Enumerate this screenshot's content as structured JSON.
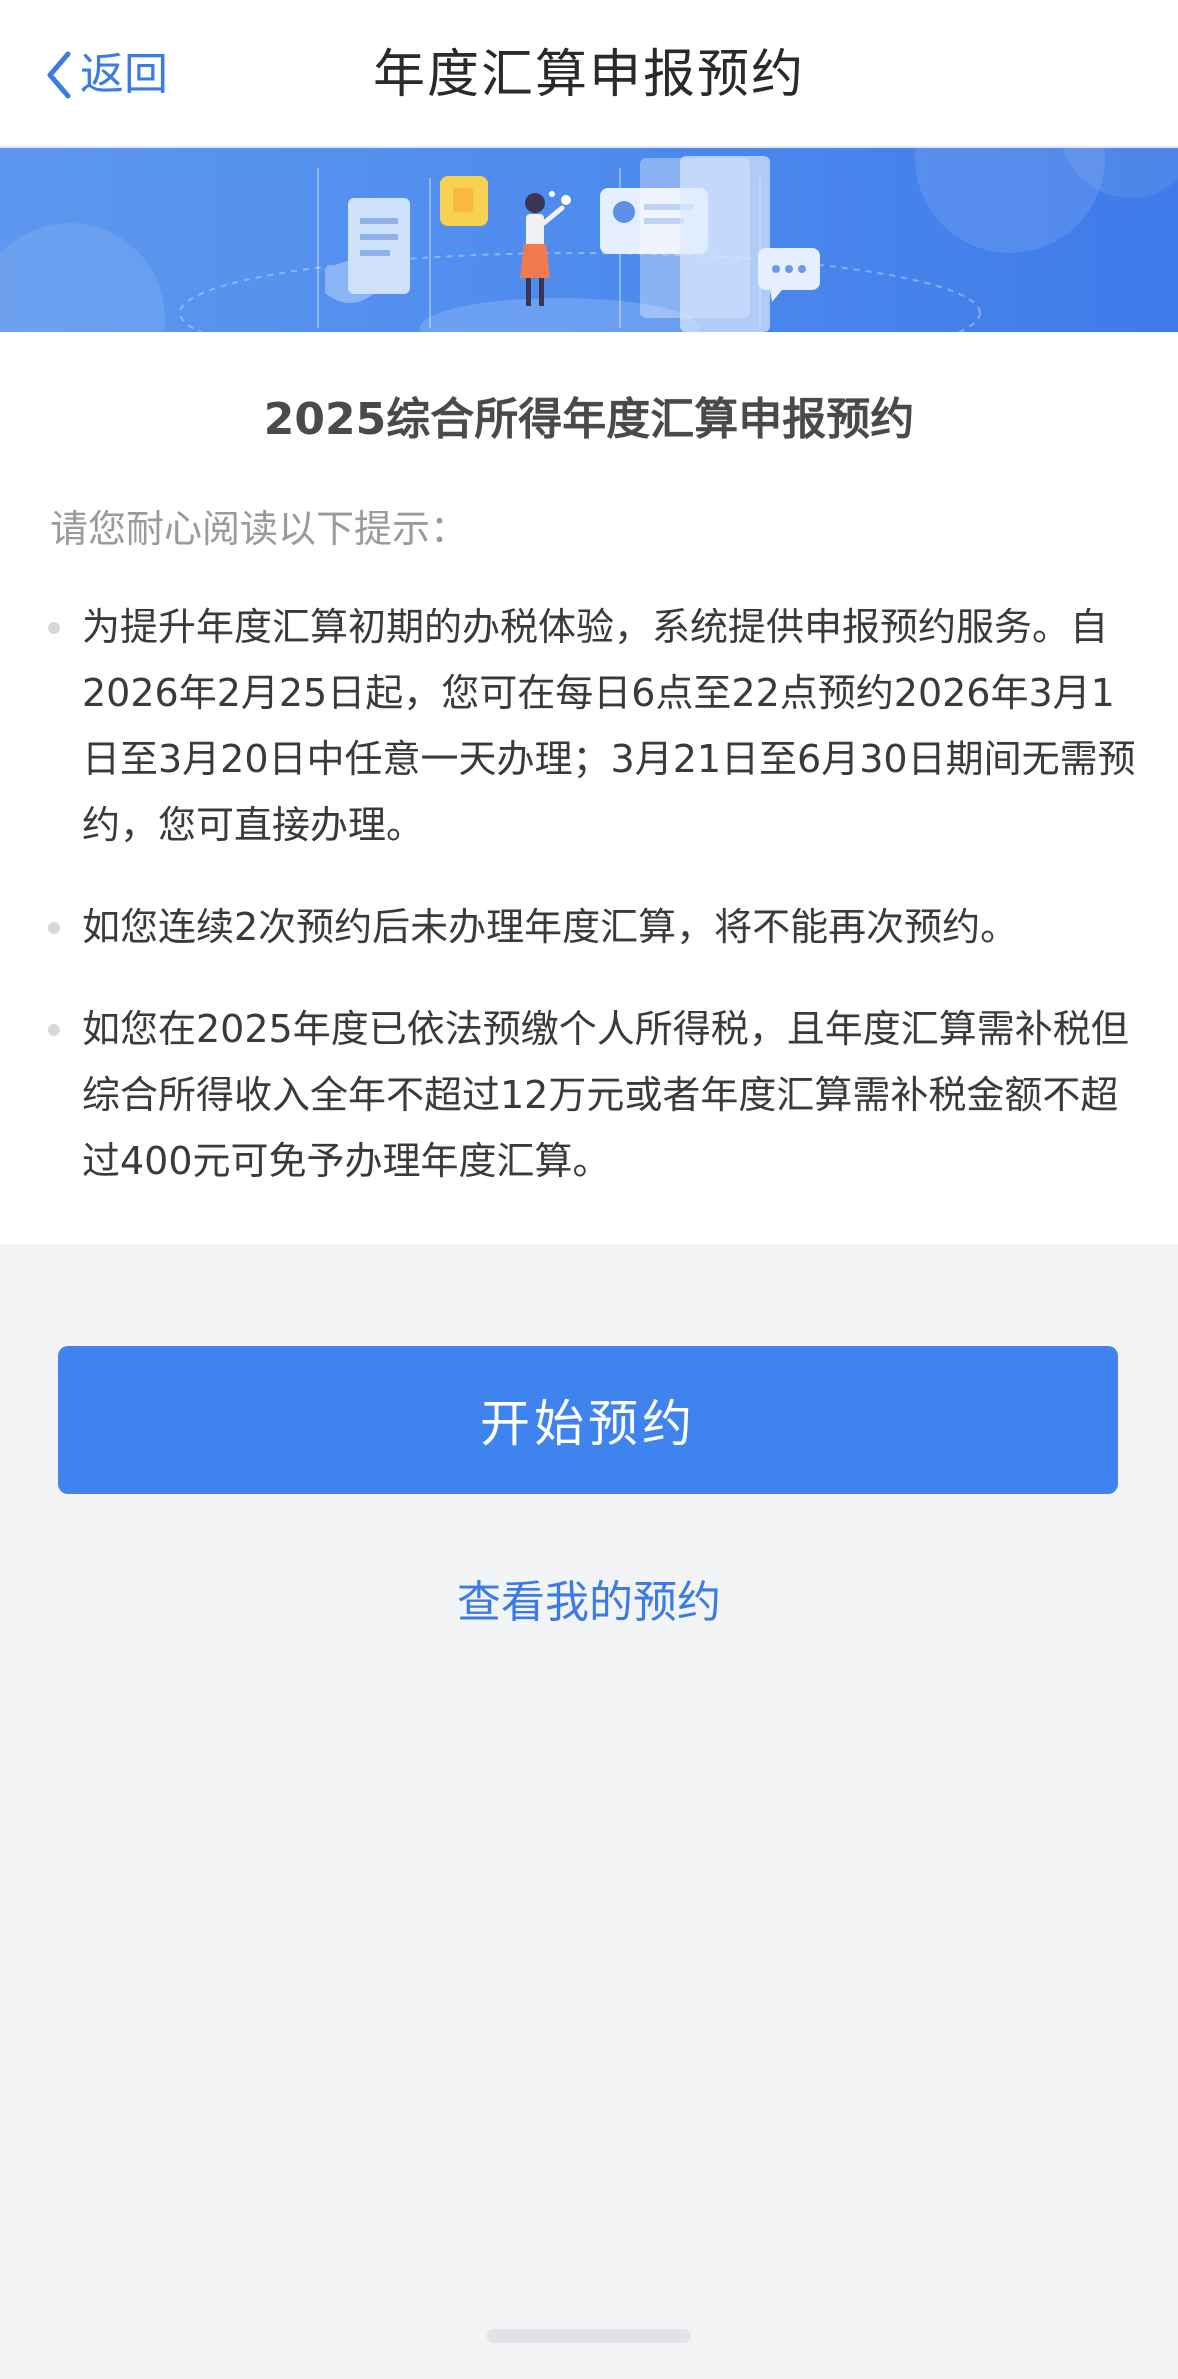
{
  "navbar": {
    "back_label": "返回",
    "title": "年度汇算申报预约"
  },
  "banner": {
    "illustration": "tax-service-illustration"
  },
  "content": {
    "title": "2025综合所得年度汇算申报预约",
    "hint": "请您耐心阅读以下提示：",
    "bullets": [
      "为提升年度汇算初期的办税体验，系统提供申报预约服务。自2026年2月25日起，您可在每日6点至22点预约2026年3月1日至3月20日中任意一天办理；3月21日至6月30日期间无需预约，您可直接办理。",
      "如您连续2次预约后未办理年度汇算，将不能再次预约。",
      "如您在2025年度已依法预缴个人所得税，且年度汇算需补税但综合所得收入全年不超过12万元或者年度汇算需补税金额不超过400元可免予办理年度汇算。"
    ]
  },
  "actions": {
    "start_label": "开始预约",
    "view_label": "查看我的预约"
  },
  "colors": {
    "accent": "#3f84ee",
    "link": "#3b7be6",
    "background": "#f3f4f6"
  }
}
